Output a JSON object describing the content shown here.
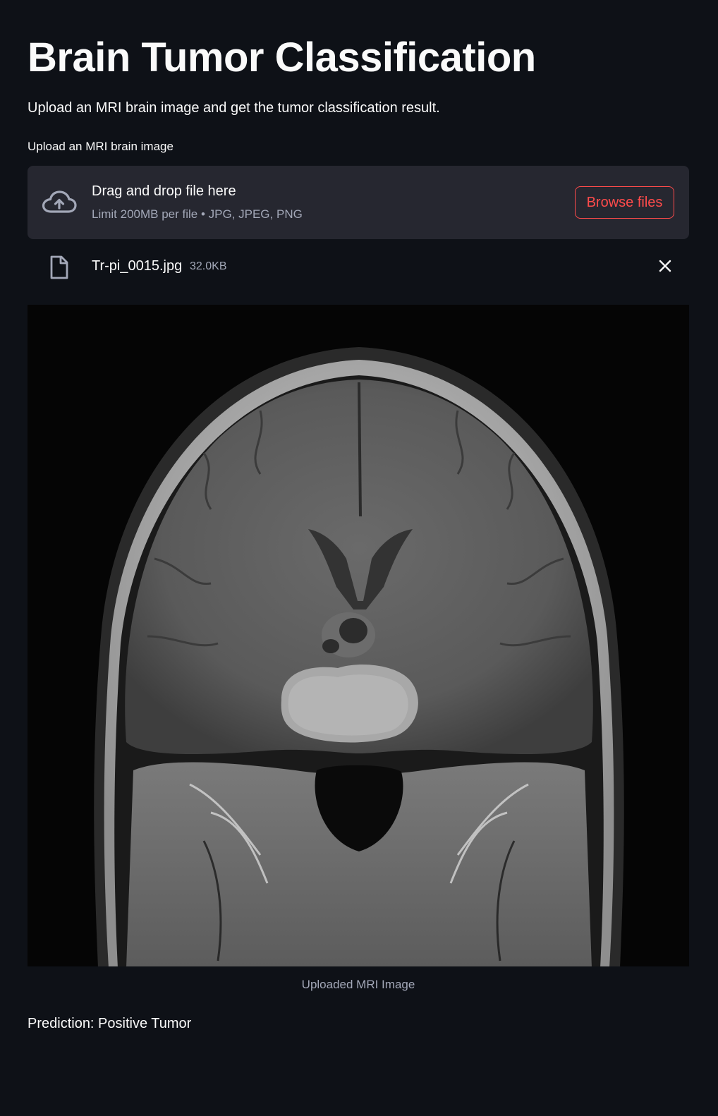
{
  "header": {
    "title": "Brain Tumor Classification",
    "subtitle": "Upload an MRI brain image and get the tumor classification result."
  },
  "uploader": {
    "label": "Upload an MRI brain image",
    "drop_title": "Drag and drop file here",
    "limit_text": "Limit 200MB per file • JPG, JPEG, PNG",
    "browse_label": "Browse files",
    "icon": "cloud-upload-icon",
    "accent_color": "#ff4b4b"
  },
  "uploaded_file": {
    "name": "Tr-pi_0015.jpg",
    "size": "32.0KB",
    "icon": "file-icon",
    "remove_icon": "close-icon"
  },
  "image": {
    "caption": "Uploaded MRI Image"
  },
  "result": {
    "prediction": "Prediction: Positive Tumor"
  }
}
